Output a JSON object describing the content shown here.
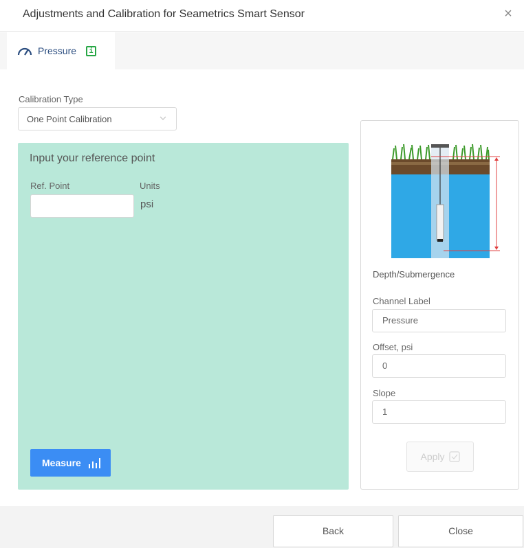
{
  "dialog": {
    "title": "Adjustments and Calibration for Seametrics Smart Sensor",
    "close_icon": "close-icon"
  },
  "tabs": [
    {
      "label": "Pressure",
      "icon": "gauge-icon",
      "info_icon": "info-icon",
      "active": true
    }
  ],
  "calibration": {
    "type_label": "Calibration Type",
    "type_value": "One Point Calibration"
  },
  "reference": {
    "heading": "Input your reference point",
    "ref_point_label": "Ref. Point",
    "ref_point_value": "",
    "units_label": "Units",
    "units_value": "psi",
    "measure_label": "Measure",
    "measure_icon": "signal-bars-icon",
    "panel_color": "#b9e8d9"
  },
  "settings": {
    "diagram_icon": "depth-submergence-diagram",
    "diagram_caption": "Depth/Submergence",
    "channel_label_label": "Channel Label",
    "channel_label_value": "Pressure",
    "offset_label": "Offset, psi",
    "offset_value": "0",
    "slope_label": "Slope",
    "slope_value": "1",
    "apply_label": "Apply",
    "apply_enabled": false
  },
  "footer": {
    "back_label": "Back",
    "close_label": "Close"
  },
  "colors": {
    "accent": "#3b8df4",
    "info_green": "#27a645",
    "tab_text": "#2c4e80"
  }
}
